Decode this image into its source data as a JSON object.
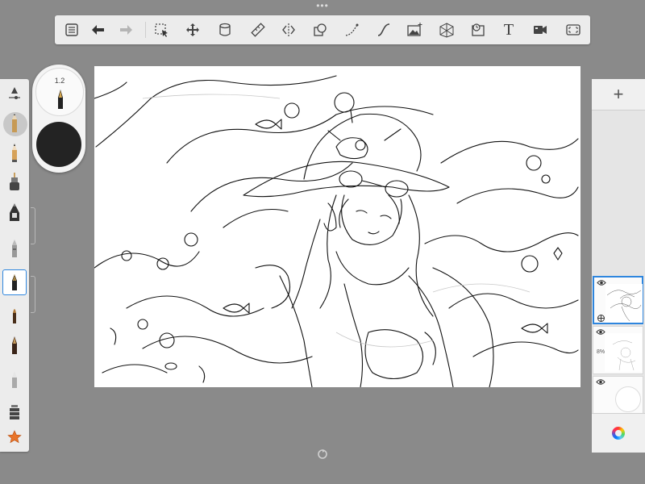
{
  "top_handle": "•••",
  "toolbar": {
    "tools": [
      "list-icon",
      "undo-icon",
      "redo-icon",
      "selection-icon",
      "move-icon",
      "bucket-icon",
      "ruler-icon",
      "symmetry-icon",
      "shapes-icon",
      "stroke-icon",
      "curve-icon",
      "image-icon",
      "perspective-icon",
      "timelapse-icon",
      "text-tool",
      "video-icon",
      "fullscreen-icon"
    ],
    "text_tool_label": "T"
  },
  "puck": {
    "brush_size": "1.2",
    "color": "#232323"
  },
  "layers": {
    "add_label": "+",
    "items": [
      {
        "visible": true,
        "selected": true
      },
      {
        "visible": true,
        "selected": false,
        "opacity": "8%"
      },
      {
        "visible": true,
        "selected": false
      }
    ]
  },
  "colors": {
    "accent": "#2e86de",
    "background": "#8a8a8a",
    "panel": "#ececec"
  }
}
